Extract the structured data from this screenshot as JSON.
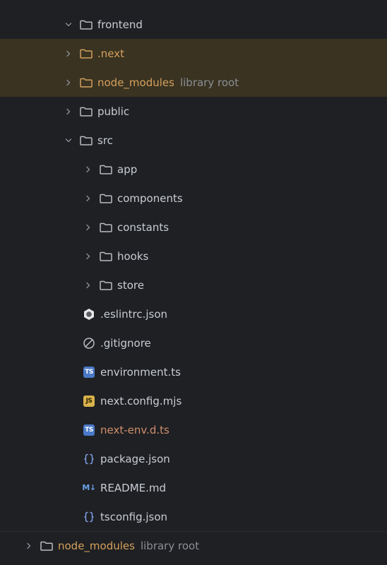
{
  "tree": [
    {
      "label": "frontend",
      "kind": "folder",
      "state": "open",
      "indent": 1,
      "hint": "",
      "icon": "folder-icon"
    },
    {
      "label": ".next",
      "kind": "folder",
      "state": "closed",
      "indent": 2,
      "hint": "",
      "excluded": true,
      "icon": "folder-icon"
    },
    {
      "label": "node_modules",
      "kind": "folder",
      "state": "closed",
      "indent": 2,
      "hint": "library root",
      "excluded": true,
      "icon": "folder-icon"
    },
    {
      "label": "public",
      "kind": "folder",
      "state": "closed",
      "indent": 2,
      "hint": "",
      "icon": "folder-icon"
    },
    {
      "label": "src",
      "kind": "folder",
      "state": "open",
      "indent": 2,
      "hint": "",
      "icon": "folder-icon"
    },
    {
      "label": "app",
      "kind": "folder",
      "state": "closed",
      "indent": 3,
      "hint": "",
      "icon": "folder-icon"
    },
    {
      "label": "components",
      "kind": "folder",
      "state": "closed",
      "indent": 3,
      "hint": "",
      "icon": "folder-icon"
    },
    {
      "label": "constants",
      "kind": "folder",
      "state": "closed",
      "indent": 3,
      "hint": "",
      "icon": "folder-icon"
    },
    {
      "label": "hooks",
      "kind": "folder",
      "state": "closed",
      "indent": 3,
      "hint": "",
      "icon": "folder-icon"
    },
    {
      "label": "store",
      "kind": "folder",
      "state": "closed",
      "indent": 3,
      "hint": "",
      "icon": "folder-icon"
    },
    {
      "label": ".eslintrc.json",
      "kind": "file",
      "indent": 2,
      "hint": "",
      "icon": "eslint-icon"
    },
    {
      "label": ".gitignore",
      "kind": "file",
      "indent": 2,
      "hint": "",
      "icon": "ignore-icon"
    },
    {
      "label": "environment.ts",
      "kind": "file",
      "indent": 2,
      "hint": "",
      "icon": "typescript-icon"
    },
    {
      "label": "next.config.mjs",
      "kind": "file",
      "indent": 2,
      "hint": "",
      "icon": "javascript-icon"
    },
    {
      "label": "next-env.d.ts",
      "kind": "file",
      "indent": 2,
      "hint": "",
      "icon": "typescript-icon",
      "modified": true
    },
    {
      "label": "package.json",
      "kind": "file",
      "indent": 2,
      "hint": "",
      "icon": "json-braces-icon"
    },
    {
      "label": "README.md",
      "kind": "file",
      "indent": 2,
      "hint": "",
      "icon": "markdown-icon"
    },
    {
      "label": "tsconfig.json",
      "kind": "file",
      "indent": 2,
      "hint": "",
      "icon": "json-braces-icon"
    },
    {
      "label": "node_modules",
      "kind": "folder",
      "state": "closed",
      "indent": 0,
      "hint": "library root",
      "bottom": true,
      "icon": "folder-icon"
    }
  ],
  "badges": {
    "ts": "TS",
    "js": "JS",
    "md": "M↓"
  },
  "colors": {
    "background": "#1f2023",
    "excluded_highlight": "#3a3322",
    "excluded_text": "#d4a05c",
    "modified_text": "#cf8e6d",
    "default_text": "#c8ccd4",
    "hint_text": "#8b8e95",
    "typescript": "#4a79c8",
    "javascript": "#d8b24b",
    "markdown": "#6aa0ea"
  }
}
